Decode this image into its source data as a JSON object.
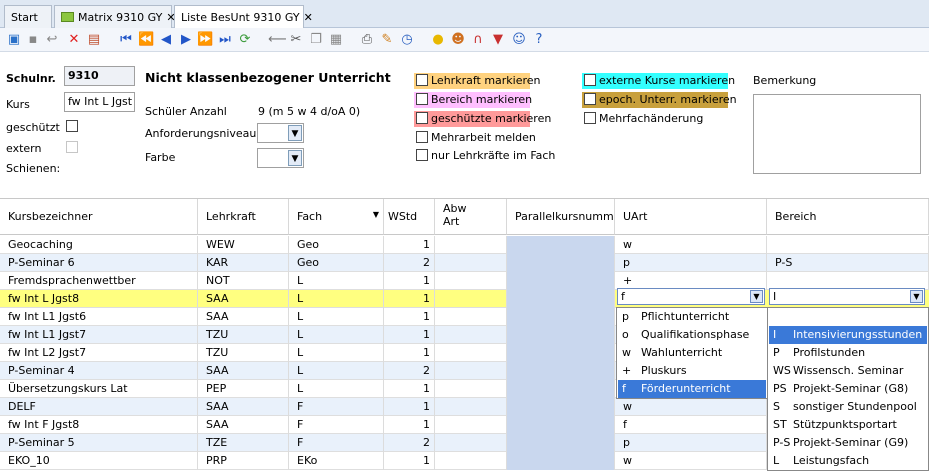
{
  "tabs": [
    {
      "label": "Start"
    },
    {
      "label": "Matrix 9310 GY"
    },
    {
      "label": "Liste BesUnt 9310 GY"
    }
  ],
  "toolbar_icons": [
    "new-icon",
    "save-icon",
    "undo-icon",
    "delete-icon",
    "calc-icon",
    "first-icon",
    "prev-page-icon",
    "prev-icon",
    "next-icon",
    "next-page-icon",
    "last-icon",
    "refresh-icon",
    "back-arrow-icon",
    "cut-icon",
    "copy-icon",
    "paste-icon",
    "print-icon",
    "brush-icon",
    "clock-icon",
    "bulb-icon",
    "users-icon",
    "magnet-icon",
    "filter-icon",
    "group-icon",
    "help-icon"
  ],
  "form": {
    "schulnr_label": "Schulnr.",
    "schulnr_value": "9310",
    "kurs_label": "Kurs",
    "kurs_value": "fw Int L Jgst",
    "geschuetzt_label": "geschützt",
    "extern_label": "extern",
    "schienen_label": "Schienen:",
    "title": "Nicht klassenbezogener Unterricht",
    "schueler_label": "Schüler Anzahl",
    "schueler_value": "9 (m 5 w 4 d/oA 0)",
    "anforderung_label": "Anforderungsniveau",
    "farbe_label": "Farbe",
    "lehrkraft_mark": "Lehrkraft markieren",
    "bereich_mark": "Bereich markieren",
    "geschuetzte_mark": "geschützte markieren",
    "mehrarbeit": "Mehrarbeit melden",
    "nur_lehrkraefte": "nur Lehrkräfte im Fach",
    "externe_mark": "externe Kurse markieren",
    "epoch_mark": "epoch. Unterr. markieren",
    "mehrfach": "Mehrfachänderung",
    "bemerkung_label": "Bemerkung",
    "colors": {
      "lehrkraft": "#ffd27f",
      "bereich": "#ffbfff",
      "geschuetzte": "#ff9a9a",
      "externe": "#33ffff",
      "epoch": "#c8a03c"
    }
  },
  "grid": {
    "headers": [
      "Kursbezeichner",
      "Lehrkraft",
      "Fach",
      "WStd",
      "Abw Art",
      "Parallelkursnummer",
      "UArt",
      "Bereich"
    ],
    "rows": [
      [
        "Geocaching",
        "WEW",
        "Geo",
        "1",
        "",
        "",
        "w",
        ""
      ],
      [
        "P-Seminar 6",
        "KAR",
        "Geo",
        "2",
        "",
        "",
        "p",
        "P-S"
      ],
      [
        "Fremdsprachenwettber",
        "NOT",
        "L",
        "1",
        "",
        "",
        "+",
        ""
      ],
      [
        "fw Int L Jgst8",
        "SAA",
        "L",
        "1",
        "",
        "",
        "f",
        "I"
      ],
      [
        "fw Int L1 Jgst6",
        "SAA",
        "L",
        "1",
        "",
        "",
        "",
        ""
      ],
      [
        "fw Int L1 Jgst7",
        "TZU",
        "L",
        "1",
        "",
        "",
        "",
        ""
      ],
      [
        "fw Int L2 Jgst7",
        "TZU",
        "L",
        "1",
        "",
        "",
        "",
        ""
      ],
      [
        "P-Seminar 4",
        "SAA",
        "L",
        "2",
        "",
        "",
        "",
        ""
      ],
      [
        "Übersetzungskurs Lat",
        "PEP",
        "L",
        "1",
        "",
        "",
        "",
        ""
      ],
      [
        "DELF",
        "SAA",
        "F",
        "1",
        "",
        "",
        "w",
        ""
      ],
      [
        "fw Int F Jgst8",
        "SAA",
        "F",
        "1",
        "",
        "",
        "f",
        ""
      ],
      [
        "P-Seminar 5",
        "TZE",
        "F",
        "2",
        "",
        "",
        "p",
        ""
      ],
      [
        "EKO_10",
        "PRP",
        "EKo",
        "1",
        "",
        "",
        "w",
        ""
      ]
    ]
  },
  "uart_dropdown": [
    {
      "code": "p",
      "label": "Pflichtunterricht"
    },
    {
      "code": "o",
      "label": "Qualifikationsphase"
    },
    {
      "code": "w",
      "label": "Wahlunterricht"
    },
    {
      "code": "+",
      "label": "Pluskurs"
    },
    {
      "code": "f",
      "label": "Förderunterricht"
    }
  ],
  "bereich_dropdown": [
    {
      "code": "",
      "label": ""
    },
    {
      "code": "I",
      "label": "Intensivierungsstunden"
    },
    {
      "code": "P",
      "label": "Profilstunden"
    },
    {
      "code": "WS",
      "label": "Wissensch. Seminar"
    },
    {
      "code": "PS",
      "label": "Projekt-Seminar (G8)"
    },
    {
      "code": "S",
      "label": "sonstiger Stundenpool"
    },
    {
      "code": "ST",
      "label": "Stützpunktsportart"
    },
    {
      "code": "P-S",
      "label": "Projekt-Seminar (G9)"
    },
    {
      "code": "L",
      "label": "Leistungsfach"
    }
  ]
}
